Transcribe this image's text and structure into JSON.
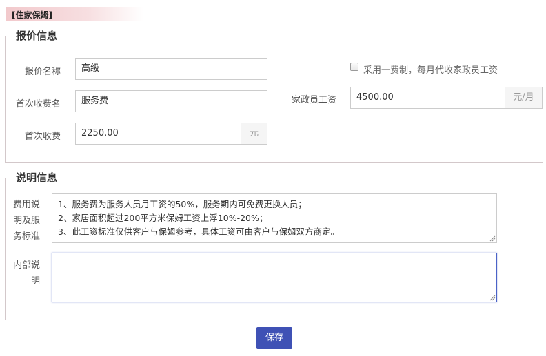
{
  "header": {
    "tag": "[住家保姆]"
  },
  "quote_section": {
    "legend": "报价信息",
    "name_label": "报价名称",
    "name_value": "高级",
    "first_fee_name_label": "首次收费名",
    "first_fee_name_value": "服务费",
    "first_fee_label": "首次收费",
    "first_fee_value": "2250.00",
    "first_fee_unit": "元",
    "unified_fee_checkbox_label": "采用一费制，每月代收家政员工资",
    "unified_fee_checked": false,
    "worker_wage_label": "家政员工资",
    "worker_wage_value": "4500.00",
    "worker_wage_unit": "元/月"
  },
  "description_section": {
    "legend": "说明信息",
    "service_desc_label": [
      "费用说",
      "明及服",
      "务标准"
    ],
    "service_desc_lines": [
      "1、服务费为服务人员月工资的50%，服务期内可免费更换人员；",
      "2、家居面积超过200平方米保姆工资上浮10%-20%；",
      "3、此工资标准仅供客户与保姆参考，具体工资可由客户与保姆双方商定。"
    ],
    "internal_note_label": [
      "内部说",
      "明"
    ],
    "internal_note_value": ""
  },
  "actions": {
    "save_label": "保存"
  },
  "colors": {
    "accent": "#3f51b5",
    "focus_border": "#4b63c7",
    "tag_bg": "#f2c9cc",
    "fieldset_border": "#d3c8ca"
  }
}
